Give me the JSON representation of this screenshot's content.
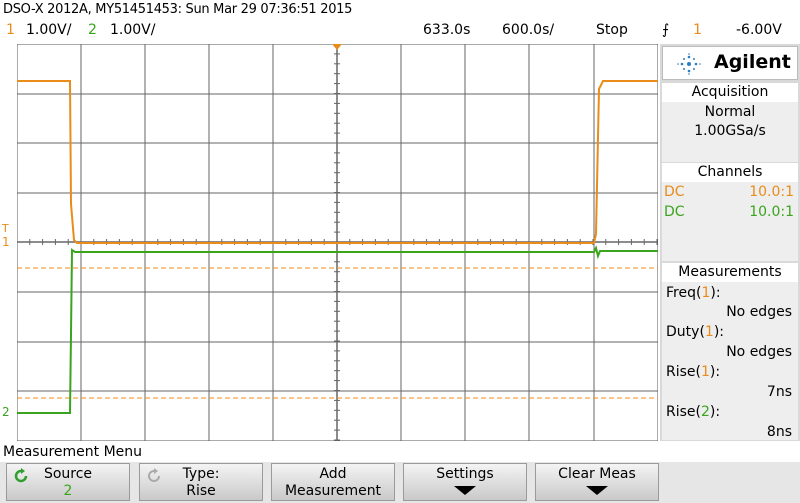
{
  "header": {
    "title": "DSO-X 2012A, MY51451453: Sun Mar 29 07:36:51 2015",
    "ch1_label": "1",
    "ch1_scale": "1.00V/",
    "ch2_label": "2",
    "ch2_scale": "1.00V/",
    "time_delay": "633.0s",
    "time_scale": "600.0s/",
    "run_state": "Stop",
    "trigger_symbol": "⨍",
    "trigger_source": "1",
    "trigger_level": "-6.00V"
  },
  "panel": {
    "brand": "Agilent",
    "acquisition": {
      "header": "Acquisition",
      "mode": "Normal",
      "rate": "1.00GSa/s"
    },
    "channels": {
      "header": "Channels",
      "rows": [
        {
          "coupling": "DC",
          "probe": "10.0:1",
          "color": "#e98c1a"
        },
        {
          "coupling": "DC",
          "probe": "10.0:1",
          "color": "#3aa51c"
        }
      ]
    },
    "measurements": {
      "header": "Measurements",
      "items": [
        {
          "name": "Freq",
          "src": "1",
          "value": "No edges"
        },
        {
          "name": "Duty",
          "src": "1",
          "value": "No edges"
        },
        {
          "name": "Rise",
          "src": "1",
          "value": "7ns"
        },
        {
          "name": "Rise",
          "src": "2",
          "value": "8ns"
        }
      ]
    }
  },
  "markers": {
    "ch1": "1",
    "ch2": "2",
    "trigger": "T"
  },
  "menu": {
    "title": "Measurement Menu",
    "keys": [
      {
        "l1": "Source",
        "l2": "2"
      },
      {
        "l1": "Type:",
        "l2": "Rise"
      },
      {
        "l1": "Add",
        "l2": "Measurement"
      },
      {
        "l1": "Settings",
        "l2": ""
      },
      {
        "l1": "Clear Meas",
        "l2": ""
      }
    ]
  },
  "colors": {
    "ch1": "#e98c1a",
    "ch2": "#3aa51c",
    "grid": "#555555",
    "background": "#ffffff"
  }
}
